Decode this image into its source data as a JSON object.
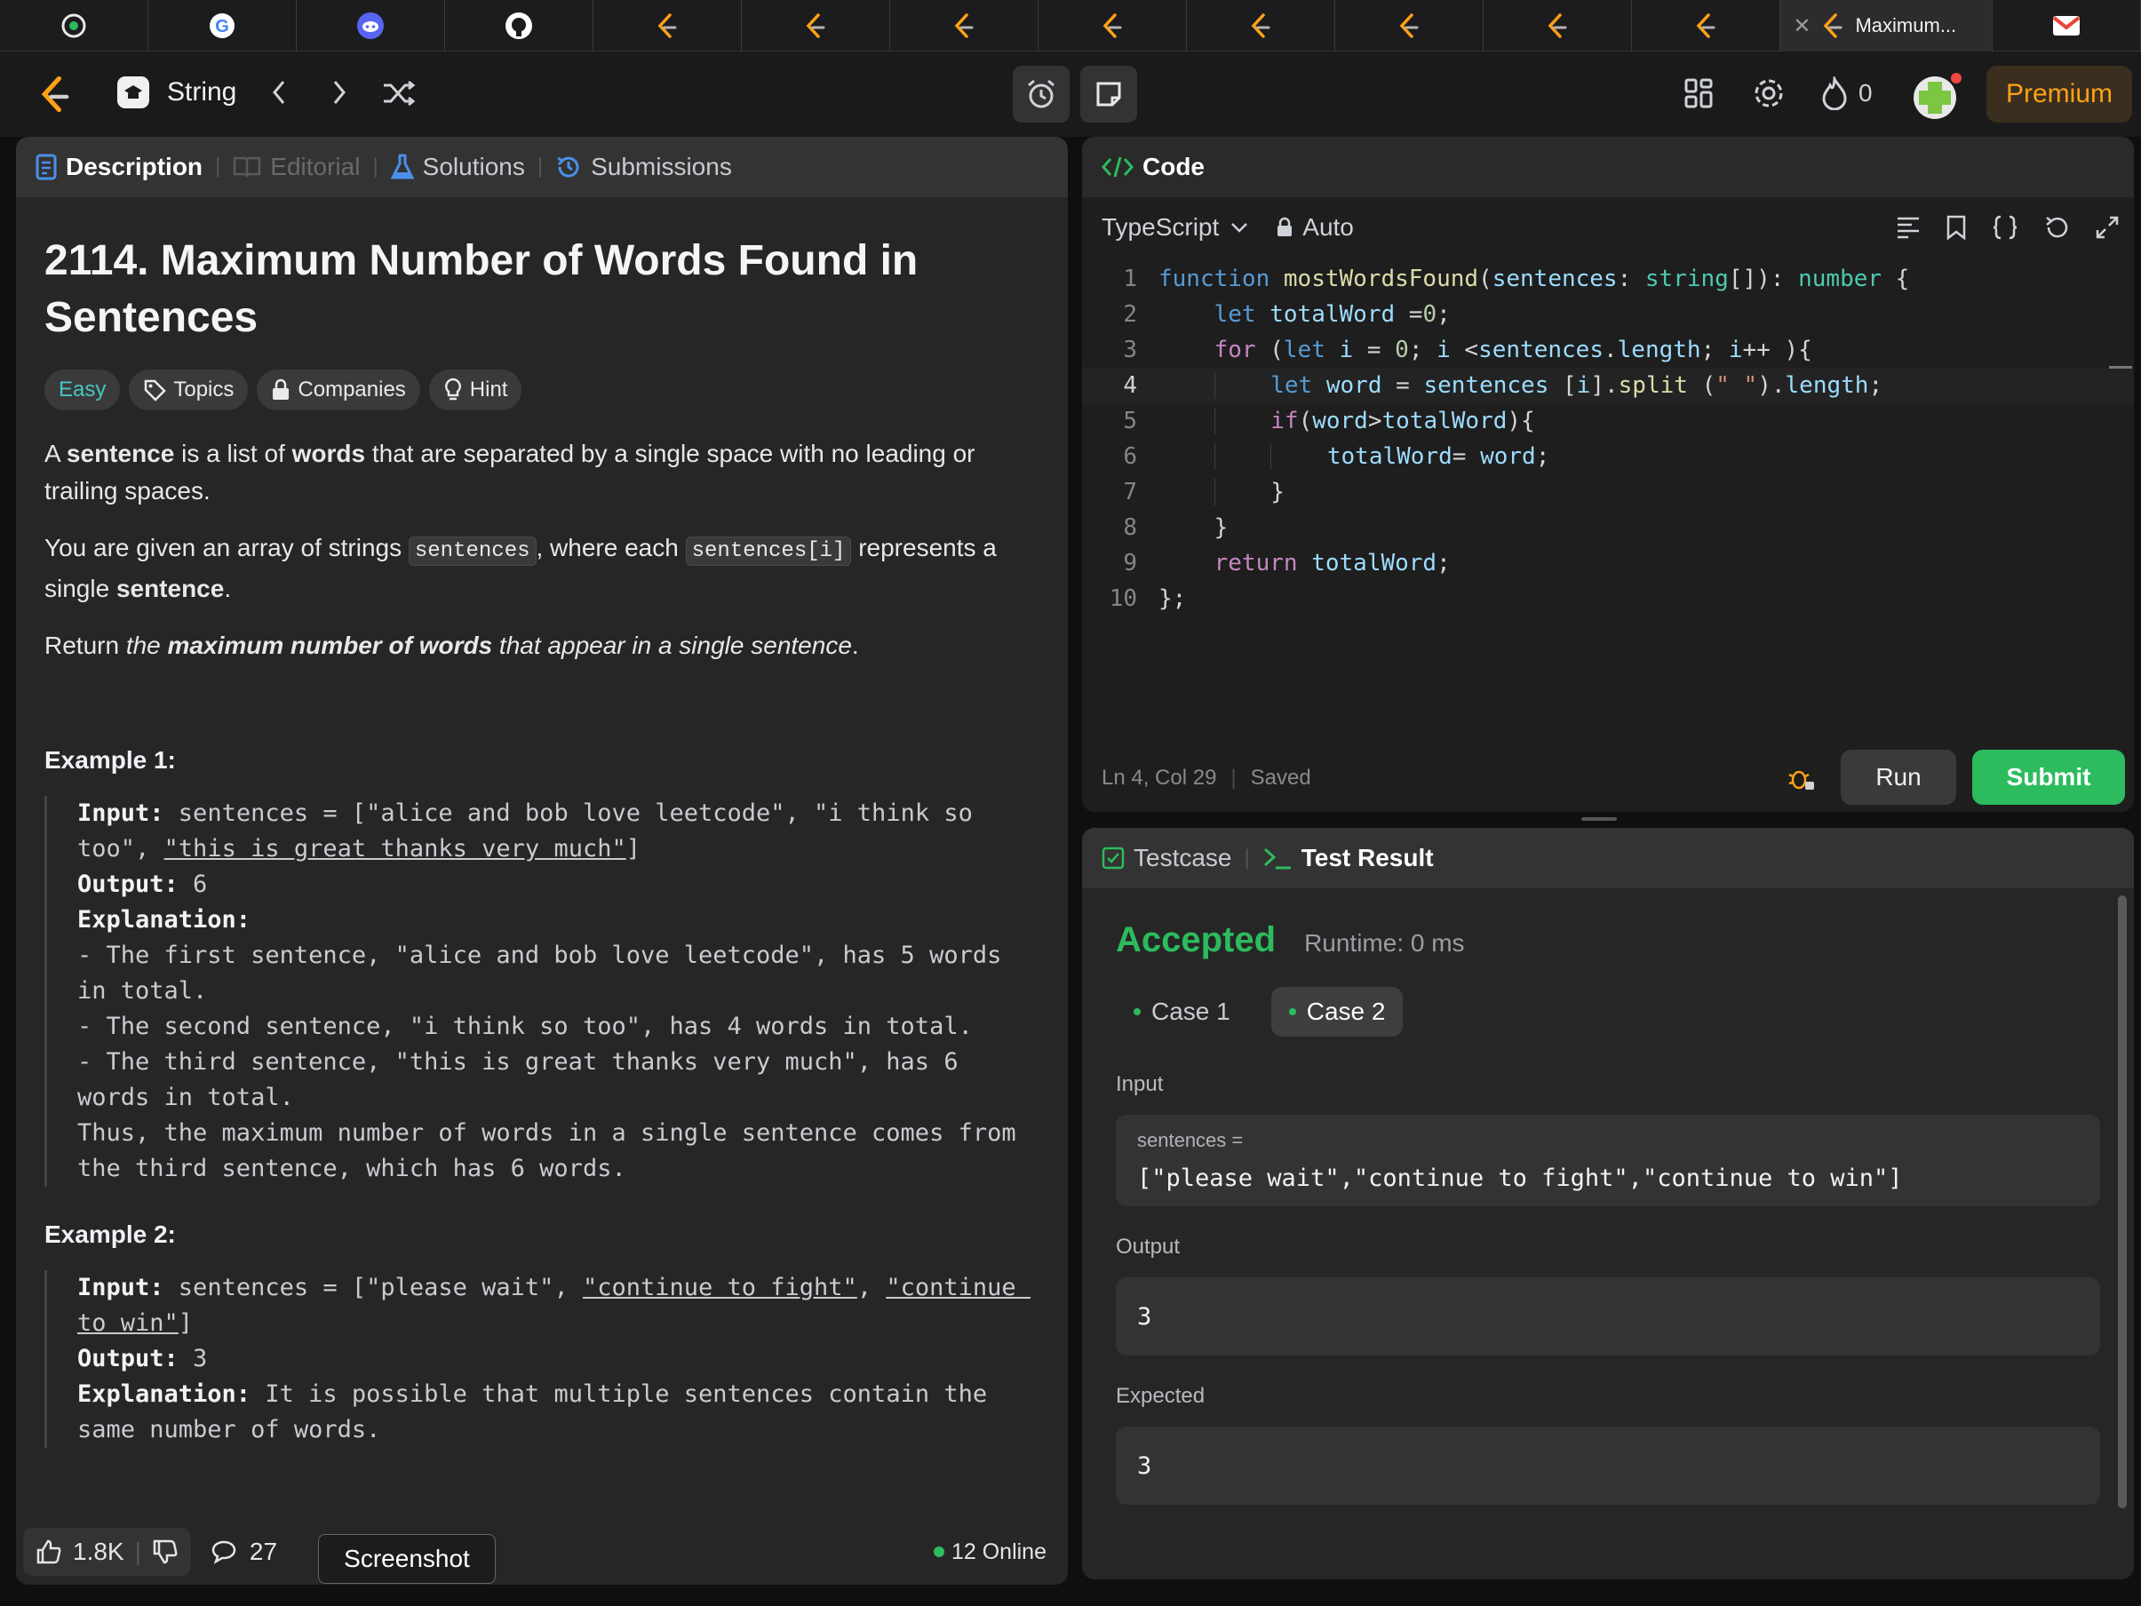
{
  "browser": {
    "active_tab_title": "Maximum...",
    "tabs": [
      "app",
      "google",
      "discord",
      "github",
      "leetcode",
      "leetcode",
      "leetcode",
      "leetcode",
      "leetcode",
      "leetcode",
      "leetcode",
      "leetcode",
      "active",
      "gmail"
    ]
  },
  "nav": {
    "problem_list": "String",
    "streak": "0",
    "premium": "Premium"
  },
  "left": {
    "tabs": [
      "Description",
      "Editorial",
      "Solutions",
      "Submissions"
    ],
    "title": "2114. Maximum Number of Words Found in Sentences",
    "chips": [
      "Easy",
      "Topics",
      "Companies",
      "Hint"
    ],
    "p1": {
      "a": "A ",
      "b1": "sentence",
      "c": " is a list of ",
      "b2": "words",
      "d": " that are separated by a single space with no leading or trailing spaces."
    },
    "p2": {
      "a": "You are given an array of strings ",
      "code1": "sentences",
      "b": ", where each ",
      "code2": "sentences[i]",
      "c": " represents a single ",
      "bold": "sentence",
      "d": "."
    },
    "p3": {
      "a": "Return ",
      "i1": "the ",
      "bi": "maximum number of words",
      "i2": " that appear in a single sentence",
      "b": "."
    },
    "example1": {
      "heading": "Example 1:",
      "input_label": "Input:",
      "input_a": " sentences = [\"alice and bob love leetcode\", \"i think so too\", ",
      "input_u": "\"this is great thanks very much\"",
      "input_b": "]",
      "output_label": "Output:",
      "output": " 6",
      "explanation_label": "Explanation:",
      "explanation": "- The first sentence, \"alice and bob love leetcode\", has 5 words in total.\n- The second sentence, \"i think so too\", has 4 words in total.\n- The third sentence, \"this is great thanks very much\", has 6 words in total.\nThus, the maximum number of words in a single sentence comes from the third sentence, which has 6 words."
    },
    "example2": {
      "heading": "Example 2:",
      "input_label": "Input:",
      "input_a": " sentences = [\"please wait\", ",
      "input_u1": "\"continue to fight\"",
      "input_comma": ", ",
      "input_u2": "\"continue to win\"",
      "input_b": "]",
      "output_label": "Output:",
      "output": " 3",
      "explanation_label": "Explanation:",
      "explanation": " It is possible that multiple sentences contain the same number of words."
    },
    "footer": {
      "likes": "1.8K",
      "comments": "27",
      "online": "12 Online",
      "tooltip": "Screenshot"
    }
  },
  "editor": {
    "header": "Code",
    "language": "TypeScript",
    "mode": "Auto",
    "status": "Ln 4, Col 29",
    "saved": "Saved",
    "run": "Run",
    "submit": "Submit"
  },
  "result": {
    "tabs": [
      "Testcase",
      "Test Result"
    ],
    "verdict": "Accepted",
    "runtime": "Runtime: 0 ms",
    "cases": [
      "Case 1",
      "Case 2"
    ],
    "input_label": "Input",
    "input_key": "sentences =",
    "input_value": "[\"please wait\",\"continue to fight\",\"continue to win\"]",
    "output_label": "Output",
    "output_value": "3",
    "expected_label": "Expected",
    "expected_value": "3"
  },
  "colors": {
    "accent_green": "#2cbb5d",
    "premium_orange": "#ffa116",
    "easy_teal": "#46c6c2"
  }
}
